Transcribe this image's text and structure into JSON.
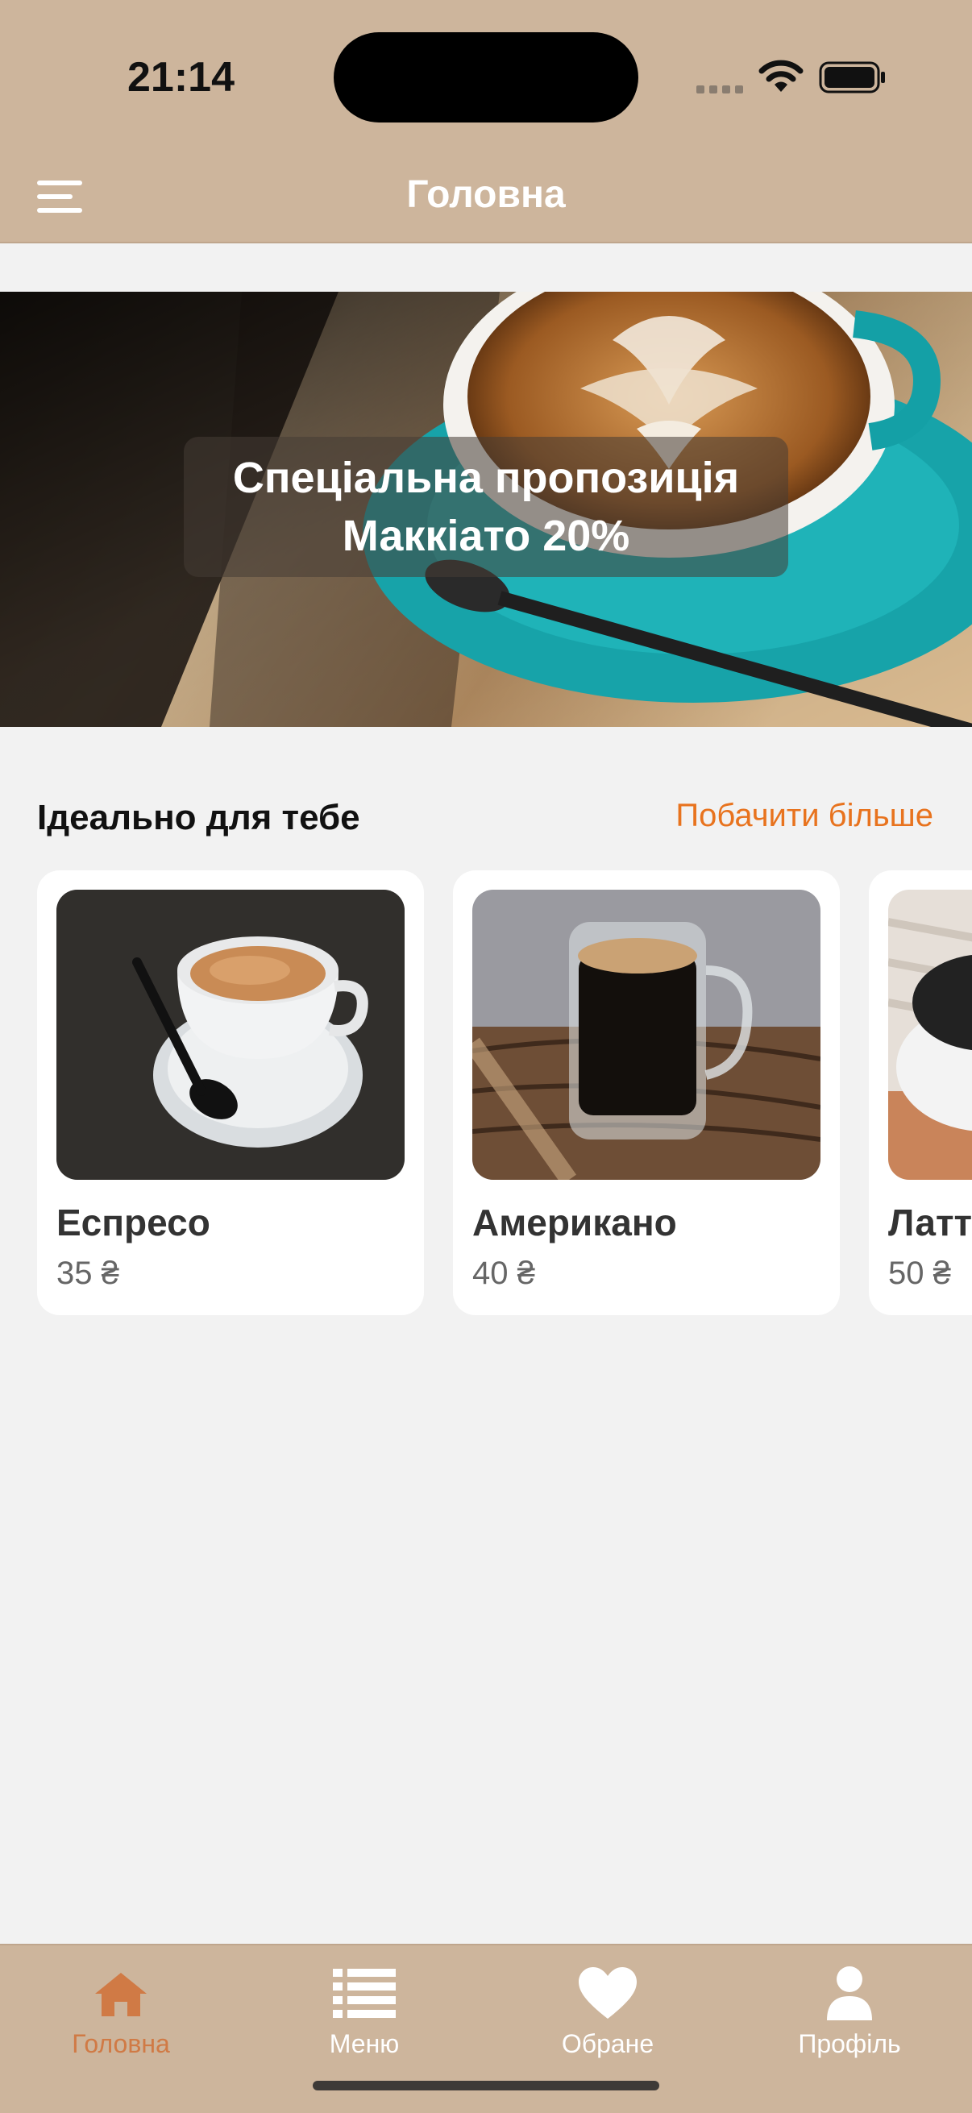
{
  "status": {
    "time": "21:14"
  },
  "header": {
    "title": "Головна"
  },
  "banner": {
    "line1": "Спеціальна пропозиція",
    "line2": "Маккіато 20%"
  },
  "section": {
    "title": "Ідеально для тебе",
    "see_more": "Побачити більше"
  },
  "products": [
    {
      "name": "Еспресо",
      "price": "35 ₴"
    },
    {
      "name": "Американо",
      "price": "40 ₴"
    },
    {
      "name": "Латте",
      "price": "50 ₴"
    }
  ],
  "tabs": [
    {
      "label": "Головна",
      "icon": "home-icon",
      "active": true
    },
    {
      "label": "Меню",
      "icon": "list-icon",
      "active": false
    },
    {
      "label": "Обране",
      "icon": "heart-icon",
      "active": false
    },
    {
      "label": "Профіль",
      "icon": "person-icon",
      "active": false
    }
  ],
  "colors": {
    "bar": "#cdb59c",
    "accent": "#e8731e",
    "active_tab": "#d07a45"
  }
}
